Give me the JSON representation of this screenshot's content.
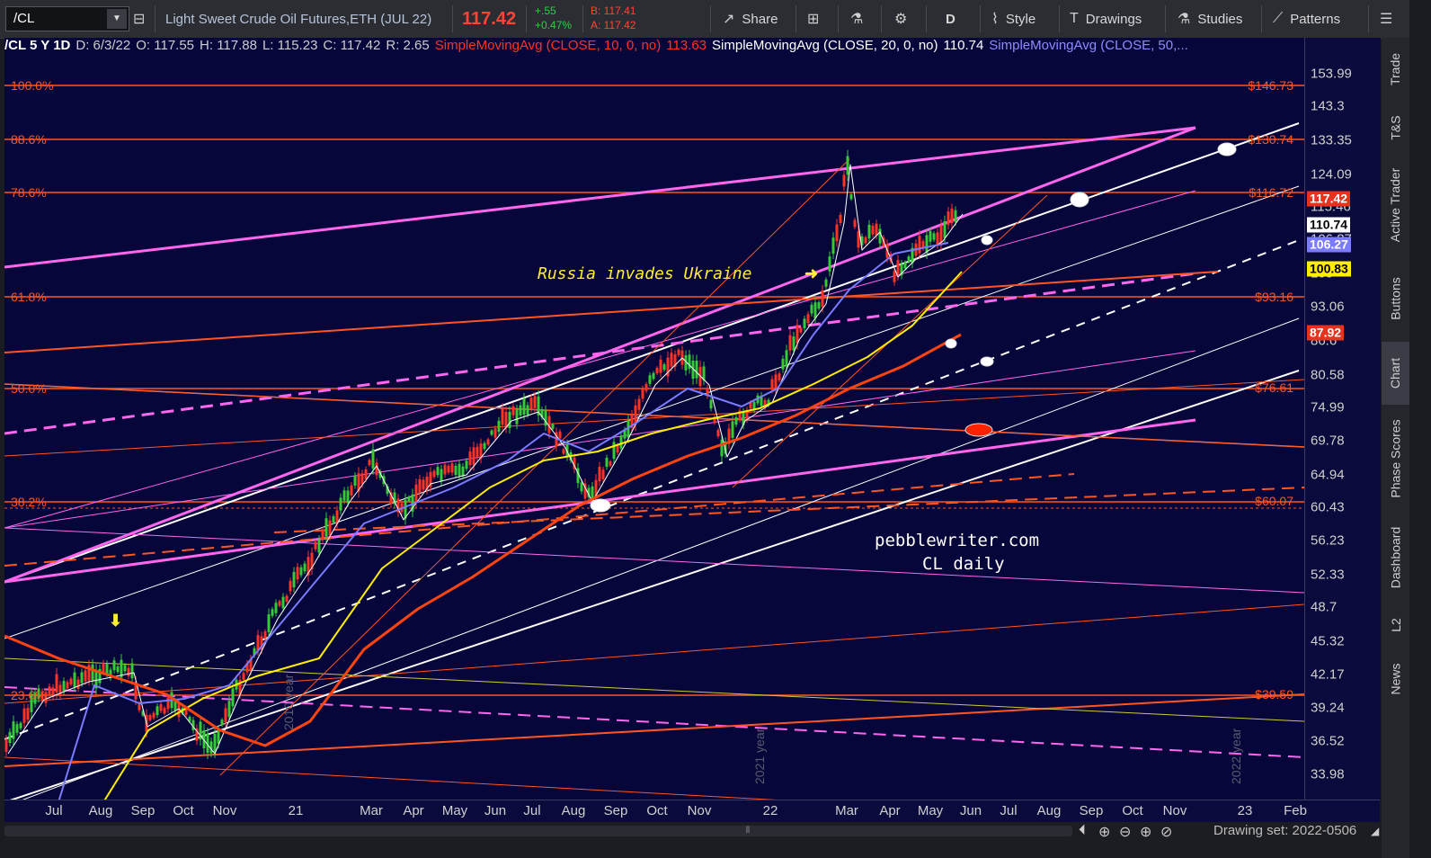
{
  "toolbar": {
    "symbol": "/CL",
    "description": "Light Sweet Crude Oil Futures,ETH (JUL 22)",
    "last": "117.42",
    "change": "+.55",
    "change_pct": "+0.47%",
    "bid": "B: 117.41",
    "ask": "A: 117.42",
    "share": "Share",
    "aggregation": "D",
    "style": "Style",
    "drawings": "Drawings",
    "studies": "Studies",
    "patterns": "Patterns"
  },
  "header": {
    "symbol_period": "/CL 5 Y 1D",
    "date": "D: 6/3/22",
    "open": "O: 117.55",
    "high": "H: 117.88",
    "low": "L: 115.23",
    "close": "C: 117.42",
    "range": "R: 2.65",
    "sma10": "SimpleMovingAvg (CLOSE, 10, 0, no)",
    "sma10_val": "113.63",
    "sma20": "SimpleMovingAvg (CLOSE, 20, 0, no)",
    "sma20_val": "110.74",
    "sma50": "SimpleMovingAvg (CLOSE, 50,..."
  },
  "fib_levels": [
    {
      "pct": "100.0%",
      "price": "$146.73"
    },
    {
      "pct": "88.6%",
      "price": "$130.74"
    },
    {
      "pct": "78.6%",
      "price": "$116.72"
    },
    {
      "pct": "61.8%",
      "price": "$93.16"
    },
    {
      "pct": "50.0%",
      "price": "$76.61"
    },
    {
      "pct": "38.2%",
      "price": "$60.07"
    },
    {
      "pct": "23.6%",
      "price": "$39.59"
    }
  ],
  "price_axis": [
    "153.99",
    "143.3",
    "133.35",
    "124.09",
    "115.46",
    "106.87",
    "100",
    "93.06",
    "86.6",
    "80.58",
    "74.99",
    "69.78",
    "64.94",
    "60.43",
    "56.23",
    "52.33",
    "48.7",
    "45.32",
    "42.17",
    "39.24",
    "36.52",
    "33.98"
  ],
  "price_tags": [
    {
      "value": "117.42",
      "bg": "#e8321e",
      "fg": "#ffffff"
    },
    {
      "value": "110.74",
      "bg": "#ffffff",
      "fg": "#000000"
    },
    {
      "value": "106.27",
      "bg": "#7b7bff",
      "fg": "#ffffff"
    },
    {
      "value": "100.83",
      "bg": "#ffee00",
      "fg": "#000000"
    },
    {
      "value": "87.92",
      "bg": "#e8321e",
      "fg": "#ffffff"
    }
  ],
  "time_axis": [
    "Jul",
    "Aug",
    "Sep",
    "Oct",
    "Nov",
    "21",
    "Mar",
    "Apr",
    "May",
    "Jun",
    "Jul",
    "Aug",
    "Sep",
    "Oct",
    "Nov",
    "22",
    "Mar",
    "Apr",
    "May",
    "Jun",
    "Jul",
    "Aug",
    "Sep",
    "Oct",
    "Nov",
    "23",
    "Feb"
  ],
  "annotations": {
    "event": "Russia invades Ukraine",
    "watermark1": "pebblewriter.com",
    "watermark2": "CL daily",
    "year1": "2010 year",
    "year2": "2021 year",
    "year3": "2022 year"
  },
  "bottom": {
    "drawing_set": "Drawing set: 2022-0506"
  },
  "right_tabs": [
    "Trade",
    "T&S",
    "Active Trader",
    "Buttons",
    "Chart",
    "Phase Scores",
    "Dashboard",
    "L2",
    "News"
  ],
  "colors": {
    "background": "#06063a",
    "fib": "#ff5522",
    "channel": "#ff66ee",
    "trend": "#ffffff",
    "sma10": "#ffffff",
    "sma20": "#7b7bff",
    "sma50": "#ffee00",
    "sma200": "#ff4411",
    "bull": "#33cc33",
    "bear": "#ff3322"
  }
}
